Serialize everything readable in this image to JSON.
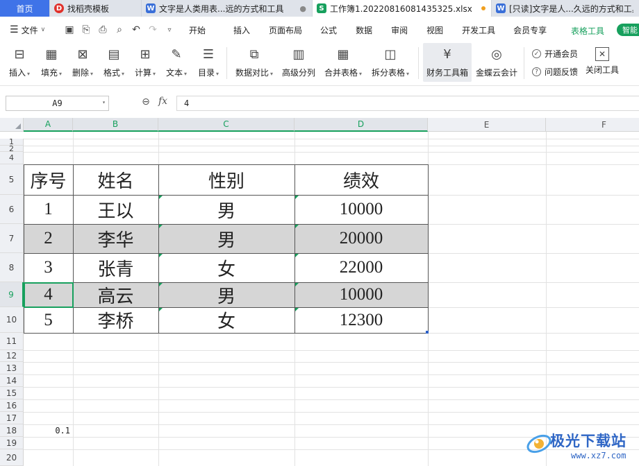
{
  "tabs": [
    {
      "label": "首页",
      "icon": "home-tab"
    },
    {
      "label": "找稻壳模板",
      "icon": "docer-icon",
      "icon_glyph": "D"
    },
    {
      "label": "文字是人类用表...远的方式和工具",
      "icon": "writer-doc-icon",
      "icon_glyph": "W",
      "close": "●"
    },
    {
      "label": "工作簿1.20220816081435325.xlsx",
      "icon": "spreadsheet-icon",
      "icon_glyph": "S",
      "active": true
    },
    {
      "label": "[只读]文字是人...久远的方式和工具",
      "icon": "writer-doc-icon",
      "icon_glyph": "W"
    }
  ],
  "menubar": {
    "file_label": "文件",
    "menus": [
      "开始",
      "插入",
      "页面布局",
      "公式",
      "数据",
      "审阅",
      "视图",
      "开发工具",
      "会员专享"
    ],
    "table_tools": "表格工具",
    "smart_label": "智能"
  },
  "ribbon": {
    "buttons": [
      {
        "label": "插入",
        "icon": "insert-icon",
        "glyph": "⊟",
        "dropdown": true
      },
      {
        "label": "填充",
        "icon": "fill-icon",
        "glyph": "▦",
        "dropdown": true
      },
      {
        "label": "删除",
        "icon": "delete-icon",
        "glyph": "⊠",
        "dropdown": true
      },
      {
        "label": "格式",
        "icon": "format-icon",
        "glyph": "▤",
        "dropdown": true
      },
      {
        "label": "计算",
        "icon": "calculate-icon",
        "glyph": "⊞",
        "dropdown": true
      },
      {
        "label": "文本",
        "icon": "text-icon",
        "glyph": "✎",
        "dropdown": true
      },
      {
        "label": "目录",
        "icon": "toc-icon",
        "glyph": "☰",
        "dropdown": true
      },
      {
        "label": "数据对比",
        "icon": "data-compare-icon",
        "glyph": "⧉",
        "dropdown": true
      },
      {
        "label": "高级分列",
        "icon": "advanced-split-icon",
        "glyph": "▥",
        "dropdown": false
      },
      {
        "label": "合并表格",
        "icon": "merge-table-icon",
        "glyph": "▦",
        "dropdown": true
      },
      {
        "label": "拆分表格",
        "icon": "split-table-icon",
        "glyph": "◫",
        "dropdown": true
      },
      {
        "label": "财务工具箱",
        "icon": "finance-toolbox-icon",
        "glyph": "¥",
        "dropdown": false
      },
      {
        "label": "金蝶云会计",
        "icon": "kingdee-icon",
        "glyph": "◎",
        "dropdown": false
      }
    ],
    "open_member": "开通会员",
    "feedback": "问题反馈",
    "close_tool": "关闭工具",
    "close_glyph": "✕"
  },
  "formula_bar": {
    "name_box": "A9",
    "fx": "fx",
    "value": "4"
  },
  "columns": [
    "A",
    "B",
    "C",
    "D",
    "E",
    "F"
  ],
  "rows": [
    "1",
    "2",
    "4",
    "5",
    "6",
    "7",
    "8",
    "9",
    "10",
    "11",
    "12",
    "13",
    "14",
    "15",
    "16",
    "17",
    "18",
    "19",
    "20"
  ],
  "table": {
    "headers": [
      "序号",
      "姓名",
      "性别",
      "绩效"
    ],
    "rows": [
      [
        "1",
        "王以",
        "男",
        "10000"
      ],
      [
        "2",
        "李华",
        "男",
        "20000"
      ],
      [
        "3",
        "张青",
        "女",
        "22000"
      ],
      [
        "4",
        "高云",
        "男",
        "10000"
      ],
      [
        "5",
        "李桥",
        "女",
        "12300"
      ]
    ]
  },
  "extra_cell": "0.1",
  "watermark": {
    "title": "极光下载站",
    "url": "www.xz7.com"
  },
  "colors": {
    "accent_green": "#17a05d",
    "home_tab": "#3f73e8",
    "band_gray": "#d6d6d6"
  }
}
